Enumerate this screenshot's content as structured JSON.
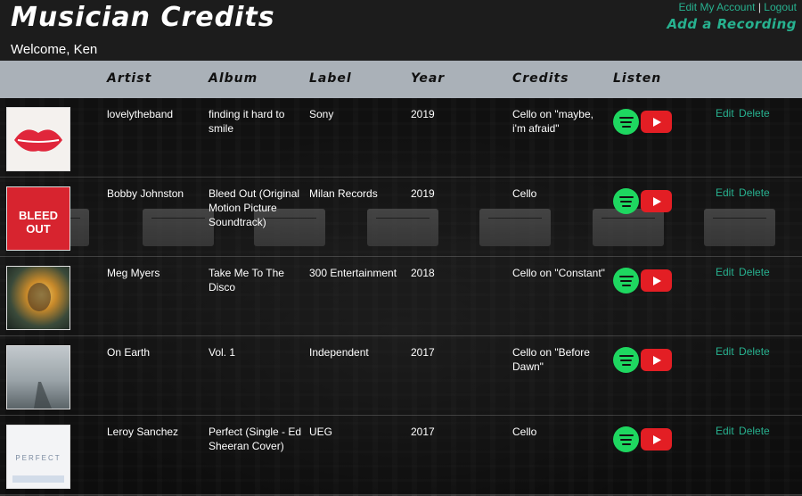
{
  "header": {
    "title": "Musician Credits",
    "welcome": "Welcome, Ken",
    "edit_account": "Edit My Account",
    "separator": "|",
    "logout": "Logout",
    "add_recording": "Add a Recording"
  },
  "table": {
    "columns": [
      "Artist",
      "Album",
      "Label",
      "Year",
      "Credits",
      "Listen"
    ],
    "edit_label": "Edit",
    "delete_label": "Delete",
    "rows": [
      {
        "artist": "lovelytheband",
        "album": "finding it hard to smile",
        "label": "Sony",
        "year": "2019",
        "credits": "Cello on \"maybe, i'm afraid\""
      },
      {
        "artist": "Bobby Johnston",
        "album": "Bleed Out (Original Motion Picture Soundtrack)",
        "label": "Milan Records",
        "year": "2019",
        "credits": "Cello"
      },
      {
        "artist": "Meg Myers",
        "album": "Take Me To The Disco",
        "label": "300 Entertainment",
        "year": "2018",
        "credits": "Cello on \"Constant\""
      },
      {
        "artist": "On Earth",
        "album": "Vol. 1",
        "label": "Independent",
        "year": "2017",
        "credits": "Cello on \"Before Dawn\""
      },
      {
        "artist": "Leroy Sanchez",
        "album": "Perfect (Single - Ed Sheeran Cover)",
        "label": "UEG",
        "year": "2017",
        "credits": "Cello"
      }
    ]
  },
  "covers": {
    "cover_2_text": "BLEED OUT",
    "cover_5_text": "PERFECT"
  },
  "colors": {
    "accent": "#27b18f",
    "spotify": "#1ed760",
    "youtube": "#e31e24",
    "header_bar": "#aab1b8"
  }
}
